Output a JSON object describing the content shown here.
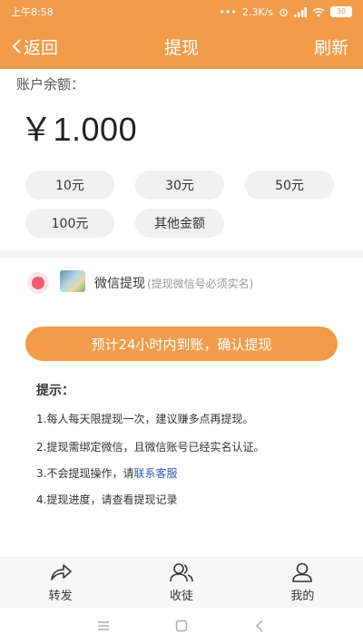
{
  "status_bar": {
    "time": "上午8:58",
    "network_speed": "2.3K/s",
    "battery": "30"
  },
  "header": {
    "back_label": "返回",
    "title": "提现",
    "refresh_label": "刷新"
  },
  "account": {
    "balance_label": "账户余额：",
    "balance_amount": "￥1.000"
  },
  "amount_options": [
    "10元",
    "30元",
    "50元",
    "100元",
    "其他金额"
  ],
  "withdraw_method": {
    "label": "微信提现",
    "note": "(提现微信号必须实名)",
    "selected": true
  },
  "confirm_button": "预计24小时内到账，确认提现",
  "tips": {
    "title": "提示：",
    "items": [
      "1.每人每天限提现一次，建议赚多点再提现。",
      "2.提现需绑定微信，且微信账号已经实名认证。",
      "3.不会提现操作，请",
      "4.提现进度，请查看提现记录"
    ],
    "contact_link": "联系客服"
  },
  "tab_bar": {
    "items": [
      {
        "label": "转发",
        "icon": "share-icon"
      },
      {
        "label": "收徒",
        "icon": "apprentice-icon"
      },
      {
        "label": "我的",
        "icon": "profile-icon"
      }
    ]
  },
  "system_nav": {
    "icons": [
      "menu-icon",
      "home-icon",
      "back-icon"
    ]
  },
  "colors": {
    "accent": "#f29b4a",
    "radio": "#f25a73",
    "link": "#2f5bb7"
  }
}
